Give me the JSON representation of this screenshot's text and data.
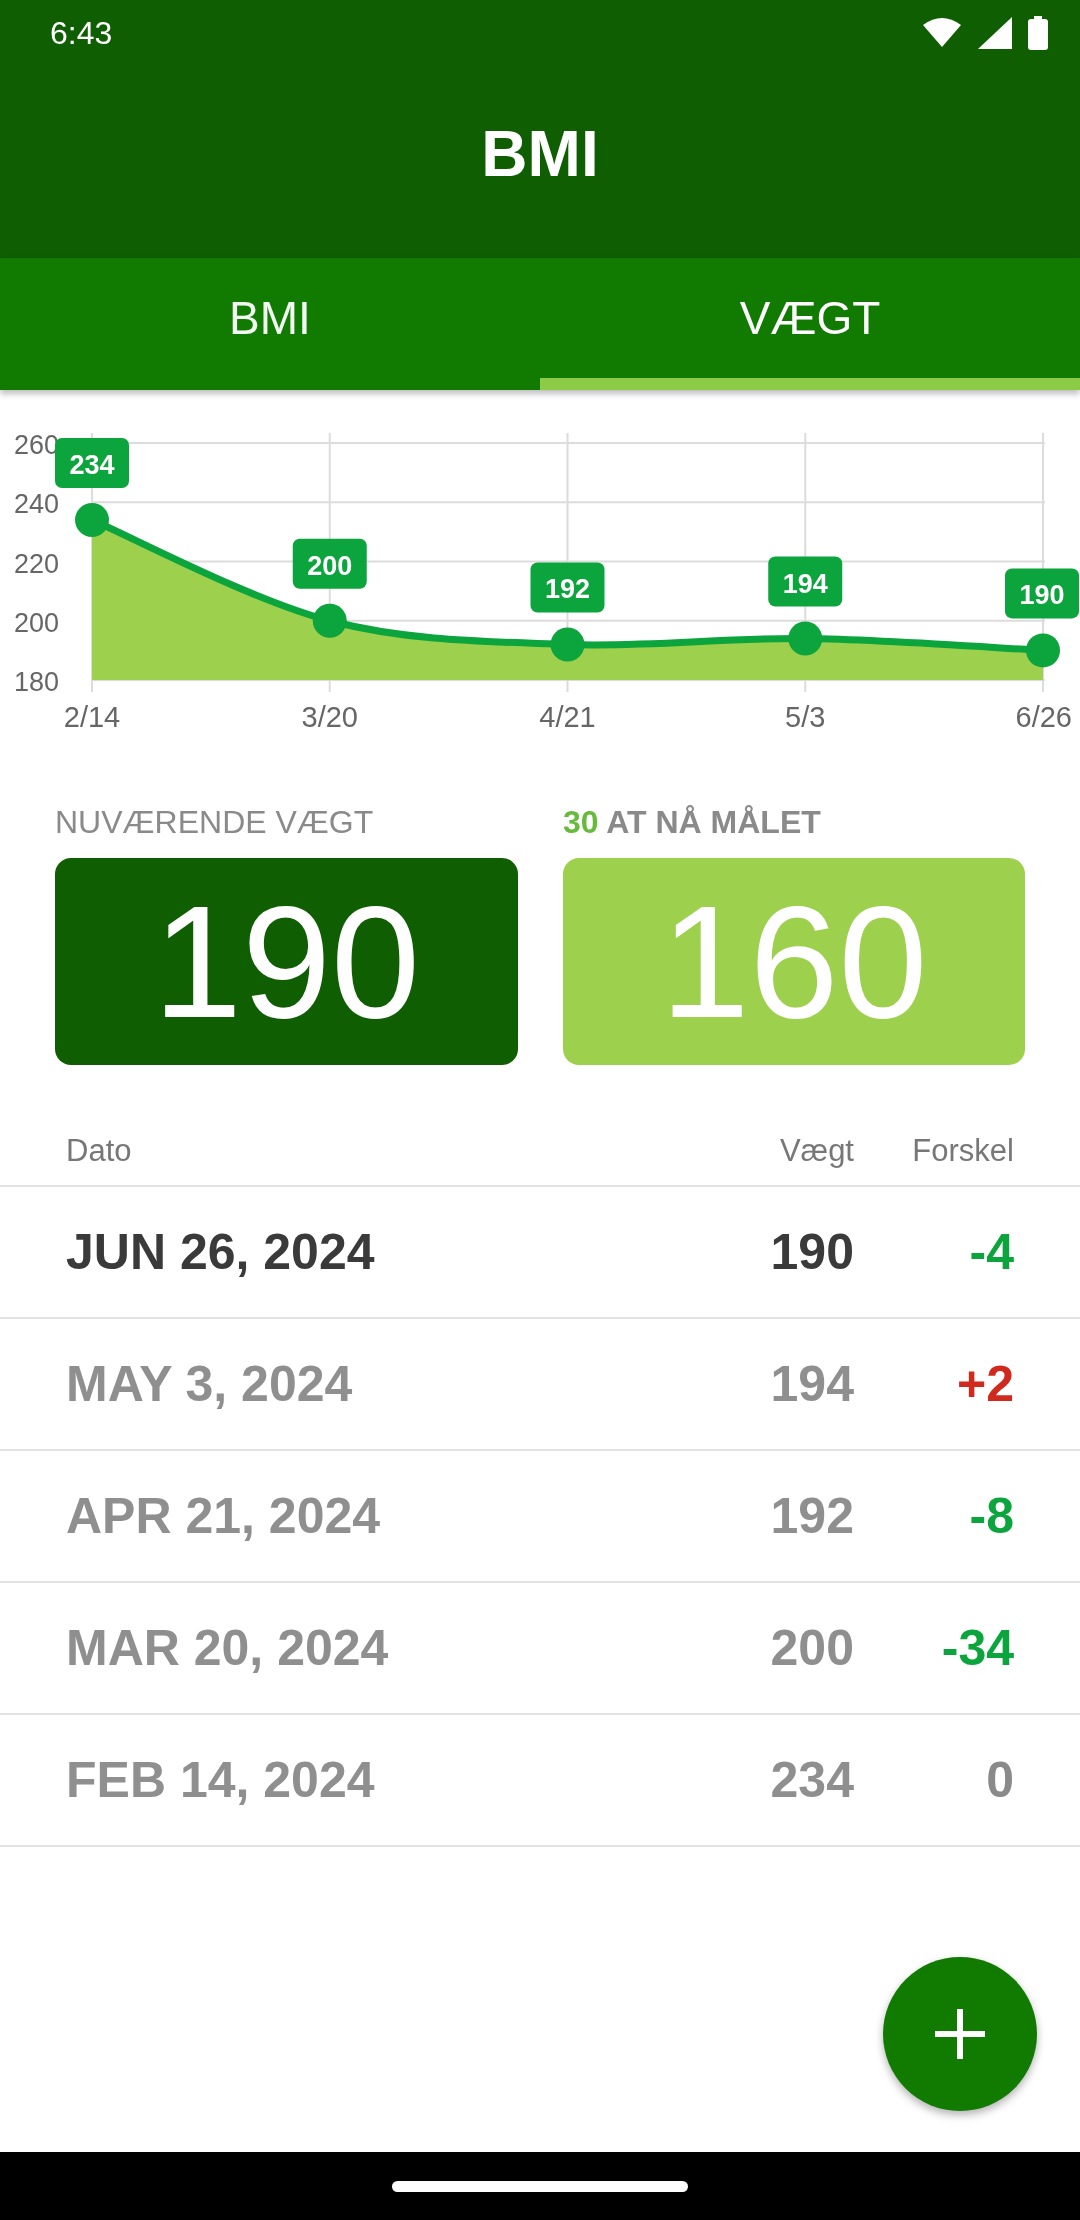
{
  "status_bar": {
    "time": "6:43"
  },
  "app_bar": {
    "title": "BMI"
  },
  "tabs": [
    {
      "label": "BMI",
      "selected": false
    },
    {
      "label": "VÆGT",
      "selected": true
    }
  ],
  "chart": {
    "chart_data": {
      "type": "area",
      "categories": [
        "2/14",
        "3/20",
        "4/21",
        "5/3",
        "6/26"
      ],
      "values": [
        234,
        200,
        192,
        194,
        190
      ],
      "ylim": [
        180,
        260
      ],
      "yticks": [
        180,
        200,
        220,
        240,
        260
      ],
      "data_labels": true,
      "grid": true,
      "value_labels": [
        "234",
        "200",
        "192",
        "194",
        "190"
      ]
    }
  },
  "current": {
    "label": "NUVÆRENDE VÆGT",
    "value": "190"
  },
  "goal": {
    "remaining": "30",
    "label": "AT NÅ MÅLET",
    "value": "160"
  },
  "table": {
    "columns": [
      "Dato",
      "Vægt",
      "Forskel"
    ],
    "rows": [
      {
        "date": "JUN 26, 2024",
        "weight": "190",
        "diff": "-4",
        "color": "#0ca43c",
        "latest": true
      },
      {
        "date": "MAY 3, 2024",
        "weight": "194",
        "diff": "+2",
        "color": "#d02a1e",
        "latest": false
      },
      {
        "date": "APR 21, 2024",
        "weight": "192",
        "diff": "-8",
        "color": "#0ca43c",
        "latest": false
      },
      {
        "date": "MAR 20, 2024",
        "weight": "200",
        "diff": "-34",
        "color": "#0ca43c",
        "latest": false
      },
      {
        "date": "FEB 14, 2024",
        "weight": "234",
        "diff": "0",
        "color": "#8a8a8a",
        "latest": false
      }
    ]
  }
}
